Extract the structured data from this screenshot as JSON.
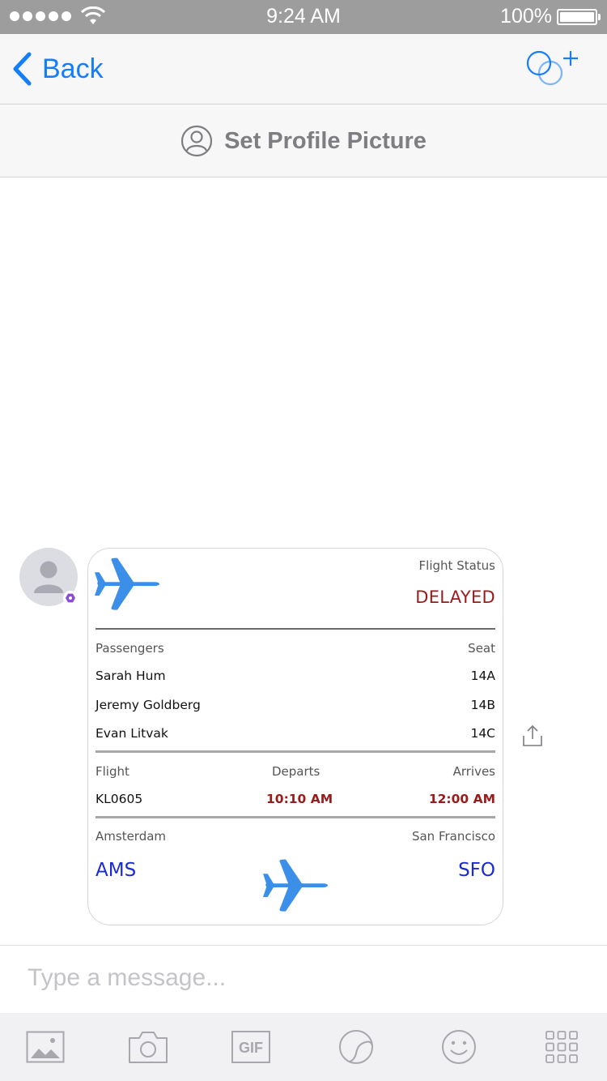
{
  "status_bar": {
    "time": "9:24 AM",
    "battery_percent": "100%",
    "signal_bars": 5,
    "battery_level": 1.0
  },
  "nav": {
    "back_label": "Back",
    "back_icon": "chevron-left-icon",
    "add_people_icon": "add-people-icon",
    "accent_color": "#147efb"
  },
  "profile": {
    "label": "Set Profile Picture",
    "icon": "profile-icon"
  },
  "card": {
    "status_label": "Flight Status",
    "status_value": "DELAYED",
    "passengers_header": "Passengers",
    "seat_header": "Seat",
    "passengers": [
      {
        "name": "Sarah Hum",
        "seat": "14A"
      },
      {
        "name": "Jeremy Goldberg",
        "seat": "14B"
      },
      {
        "name": "Evan Litvak",
        "seat": "14C"
      }
    ],
    "flight_header": "Flight",
    "departs_header": "Departs",
    "arrives_header": "Arrives",
    "flight_number": "KL0605",
    "departs_time": "10:10 AM",
    "arrives_time": "12:00 AM",
    "origin_city": "Amsterdam",
    "destination_city": "San Francisco",
    "origin_code": "AMS",
    "destination_code": "SFO",
    "status_color": "#9b1b1b",
    "code_color": "#1a2ad6",
    "plane_color": "#3b8fe8"
  },
  "composer": {
    "placeholder": "Type a message..."
  },
  "toolbar": {
    "items": [
      "photo-icon",
      "camera-icon",
      "gif-icon",
      "sticker-icon",
      "emoji-icon",
      "apps-grid-icon"
    ],
    "gif_label": "GIF"
  }
}
